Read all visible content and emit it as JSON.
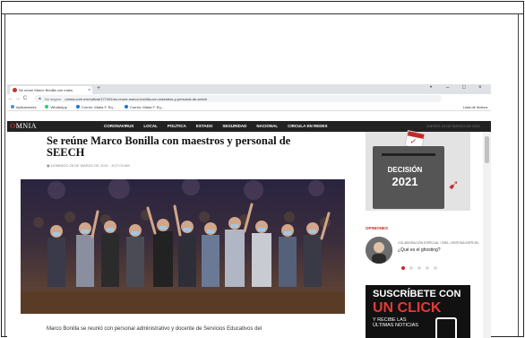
{
  "browser": {
    "tab_title": "Se reúne Marco Bonilla con maes",
    "tab_close": "×",
    "new_tab": "+",
    "window_controls": [
      "•",
      "–",
      "□",
      "×"
    ],
    "nav": {
      "back": "←",
      "forward": "→",
      "reload": "C"
    },
    "security_label": "No seguro",
    "url": "omnia.com.mx/noticia/177491/se-reune-marco-bonilla-con-maestros-y-personal-de-seech",
    "bookmarks": [
      "Aplicaciones",
      "WhatsApp",
      "Correo: Maria F. Eq...",
      "Correo: Maria F. Eq..."
    ],
    "reading_list": "Lista de lectura"
  },
  "site": {
    "logo_first": "O",
    "logo_rest": "MNIA",
    "nav": [
      "CORONAVIRUS",
      "LOCAL",
      "POLÍTICA",
      "ESTADO",
      "SEGURIDAD",
      "NACIONAL",
      "CIRCULA EN REDES"
    ],
    "nav_right": "JUEVES 23 DE MARZO DE 2021"
  },
  "article": {
    "headline": "Se reúne Marco Bonilla con maestros y personal de SEECH",
    "dateline": "DOMINGO 28 DE MARZO DE 2021 · 8:27:03 AM",
    "paragraph_start": "Marco Bonilla se reunió con personal administrativo y docente de Servicios Educativos del"
  },
  "sidebar": {
    "ad_word": "DECISIÓN",
    "ad_year": "2021",
    "opinion_label": "OPINIONES",
    "opinion_author": "COLABORACIÓN ESPECIAL / DRA. CRISTINA ESPEJEL",
    "opinion_title": "¿Qué es el ghosting?",
    "subscribe_line1": "SUSCRÍBETE CON",
    "subscribe_line2": "UN CLICK",
    "subscribe_line3a": "Y RECIBE LAS",
    "subscribe_line3b": "ÚLTIMAS NOTICIAS"
  },
  "colors": {
    "brand_red": "#c62828",
    "nav_bg": "#222222"
  }
}
